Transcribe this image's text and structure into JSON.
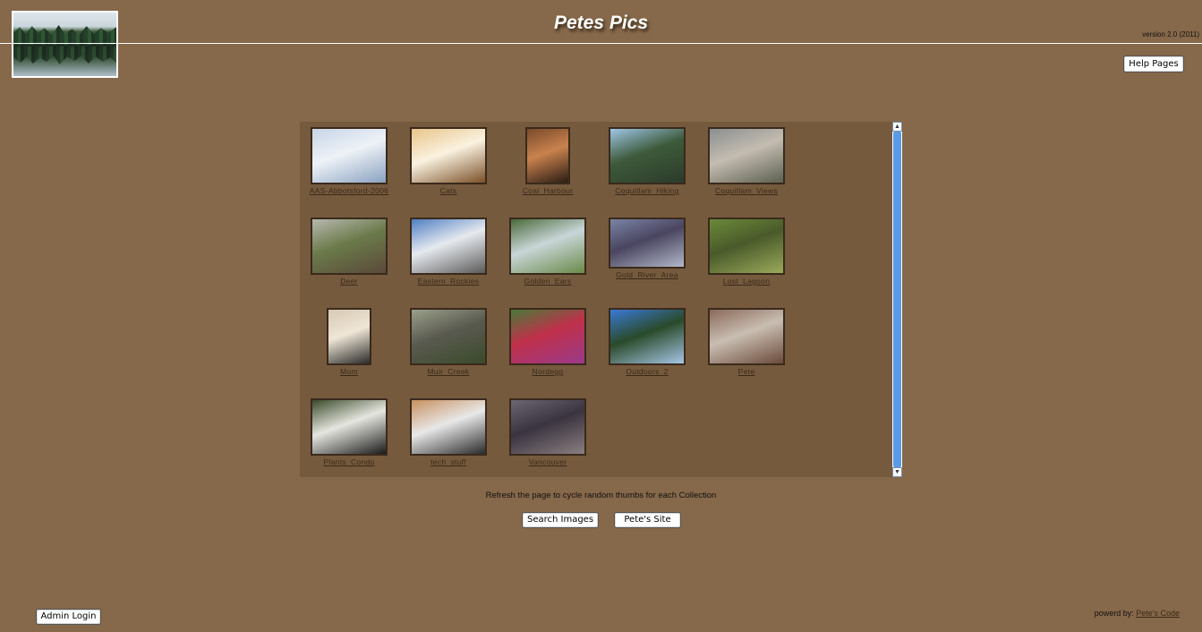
{
  "header": {
    "title": "Petes Pics",
    "version": "version 2.0 (2011)",
    "help_label": "Help Pages"
  },
  "collections": [
    {
      "label": "AAS-Abbotsford-2006",
      "colors": [
        "#c7d4e6",
        "#eef2f7",
        "#8aa2c0"
      ]
    },
    {
      "label": "Cats",
      "colors": [
        "#e8c48a",
        "#faf2e0",
        "#7a5028"
      ]
    },
    {
      "label": "Coal_Harbour",
      "colors": [
        "#7a4a2a",
        "#c9824e",
        "#2a1c14"
      ]
    },
    {
      "label": "Coquitlam_Hiking",
      "colors": [
        "#9fc6e6",
        "#3d5a3a",
        "#2c3b2b"
      ]
    },
    {
      "label": "Coquitlam_Views",
      "colors": [
        "#8a8f90",
        "#c4bcb0",
        "#5c6050"
      ]
    },
    {
      "label": "Deer",
      "colors": [
        "#b8b8b0",
        "#6b7a4a",
        "#5a4a3a"
      ]
    },
    {
      "label": "Eastern_Rockies",
      "colors": [
        "#4f7ec2",
        "#e6eaef",
        "#5a5a58"
      ]
    },
    {
      "label": "Golden_Ears",
      "colors": [
        "#4a6a3a",
        "#c9d6d8",
        "#6a8a4a"
      ]
    },
    {
      "label": "Gold_River_Area",
      "colors": [
        "#7a84a6",
        "#4a4560",
        "#b2b8c9"
      ]
    },
    {
      "label": "Lost_Lagoon",
      "colors": [
        "#6a8a3a",
        "#4a5a2a",
        "#9aaa5a"
      ]
    },
    {
      "label": "Mom",
      "colors": [
        "#d6c8b4",
        "#efe6d6",
        "#2a2a2a"
      ]
    },
    {
      "label": "Muir_Creek",
      "colors": [
        "#9aa08a",
        "#5a5a50",
        "#3a4a2a"
      ]
    },
    {
      "label": "Nordegg",
      "colors": [
        "#4a7a3a",
        "#c0304a",
        "#9a3a8a"
      ]
    },
    {
      "label": "Outdoors_2",
      "colors": [
        "#3a7ad6",
        "#2a4a2a",
        "#a6c6e6"
      ]
    },
    {
      "label": "Pete",
      "colors": [
        "#8a6a5a",
        "#c9beb2",
        "#6a4a3a"
      ]
    },
    {
      "label": "Plants_Condo",
      "colors": [
        "#3a4a2a",
        "#e6e6e0",
        "#1a1a1a"
      ]
    },
    {
      "label": "tech_stuff",
      "colors": [
        "#c89060",
        "#e8e8e8",
        "#2a2a2a"
      ]
    },
    {
      "label": "Vancouver",
      "colors": [
        "#6a6672",
        "#3a3440",
        "#8a7e80"
      ]
    }
  ],
  "refresh_note": "Refresh the page to cycle random thumbs for each Collection",
  "buttons": {
    "search": "Search Images",
    "site": "Pete's Site",
    "admin": "Admin Login"
  },
  "footer": {
    "powered_prefix": "powerd by:",
    "powered_link": "Pete's Code"
  }
}
